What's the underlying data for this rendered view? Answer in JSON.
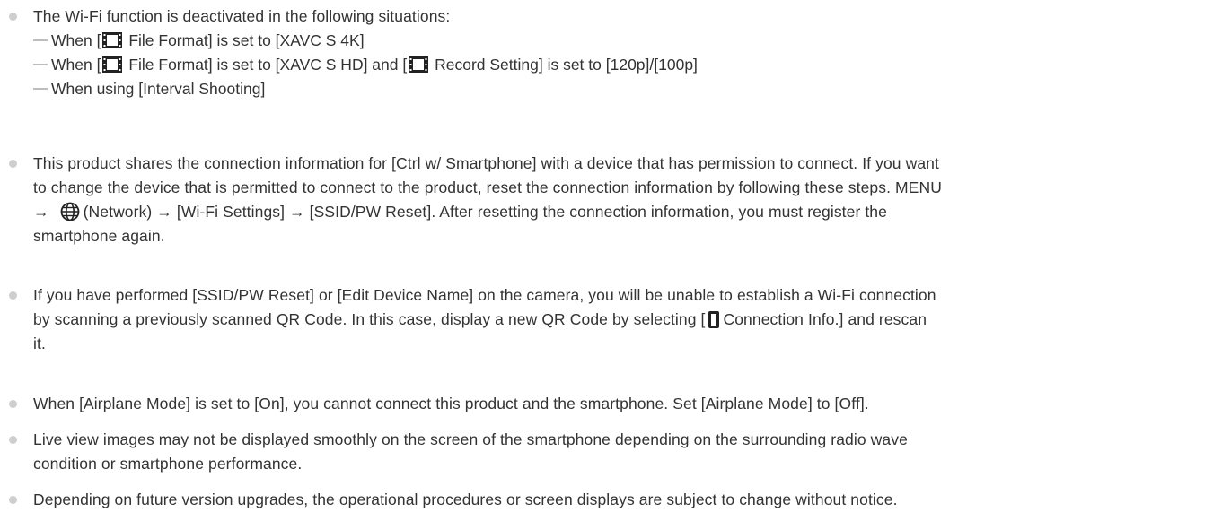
{
  "notes": {
    "wifi": {
      "intro": "The Wi-Fi function is deactivated in the following situations:",
      "cases": [
        {
          "pre": "When [",
          "post": " File Format] is set to [XAVC S 4K]"
        },
        {
          "pre": "When [",
          "mid": " File Format] is set to [XAVC S HD] and [",
          "post": " Record Setting] is set to [120p]/[100p]"
        },
        {
          "pre": "When using [Interval Shooting]"
        }
      ],
      "icon": "movie-film-icon"
    },
    "shares": {
      "line1": "This product shares the connection information for [Ctrl w/ Smartphone] with a device that has permission to connect. If you want",
      "line2": "to change the device that is permitted to connect to the product, reset the connection information by following these steps. MENU",
      "line3_pre": "→",
      "line3_post": "(Network) → [Wi-Fi Settings] → [SSID/PW Reset]. After resetting the connection information, you must register the",
      "line4": "smartphone again.",
      "icon": "network-globe-icon"
    },
    "ssid": {
      "line1": "If you have performed [SSID/PW Reset] or [Edit Device Name] on the camera, you will be unable to establish a Wi-Fi connection",
      "line2_pre": "by scanning a previously scanned QR Code. In this case, display a new QR Code by selecting [",
      "line2_post": "Connection Info.] and rescan",
      "line3": "it.",
      "icon": "smartphone-icon"
    },
    "airplane": "When [Airplane Mode] is set to [On], you cannot connect this product and the smartphone. Set [Airplane Mode] to [Off].",
    "liveview": {
      "line1": "Live view images may not be displayed smoothly on the screen of the smartphone depending on the surrounding radio wave",
      "line2": "condition or smartphone performance."
    },
    "upgrades": "Depending on future version upgrades, the operational procedures or screen displays are subject to change without notice."
  }
}
